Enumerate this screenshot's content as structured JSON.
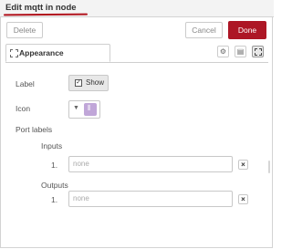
{
  "header": {
    "title": "Edit mqtt in node"
  },
  "toolbar": {
    "delete_label": "Delete",
    "cancel_label": "Cancel",
    "done_label": "Done"
  },
  "tabs": {
    "appearance_label": "Appearance"
  },
  "tab_icons": [
    "gear-icon",
    "document-icon",
    "appearance-icon"
  ],
  "form": {
    "label_caption": "Label",
    "show_button_label": "Show",
    "icon_caption": "Icon",
    "port_labels_caption": "Port labels",
    "inputs_caption": "Inputs",
    "inputs_index": "1.",
    "inputs_placeholder": "none",
    "outputs_caption": "Outputs",
    "outputs_index": "1.",
    "outputs_placeholder": "none"
  },
  "colors": {
    "accent": "#ad1625",
    "icon_swatch": "#c0a6d8"
  }
}
